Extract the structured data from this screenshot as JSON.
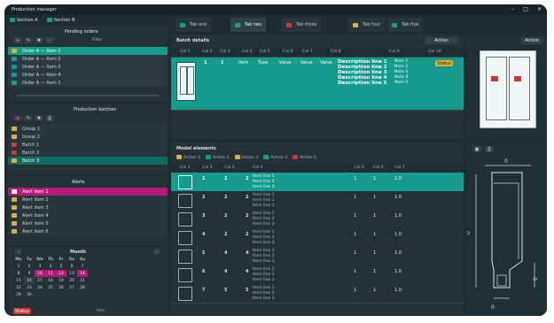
{
  "window": {
    "title": "Production manager"
  },
  "top": {
    "left_header_a": "Section A",
    "left_header_b": "Section B",
    "tabs": [
      {
        "label": "Tab one"
      },
      {
        "label": "Tab two"
      },
      {
        "label": "Tab three"
      },
      {
        "label": "Tab four"
      },
      {
        "label": "Tab five"
      }
    ]
  },
  "left": {
    "pending_title": "Pending orders",
    "pending_filter": "Filter",
    "pending_rows": [
      {
        "text": "Order A — Item 1"
      },
      {
        "text": "Order A — Item 2"
      },
      {
        "text": "Order A — Item 3"
      },
      {
        "text": "Order A — Item 4"
      },
      {
        "text": "Order B — Item 1"
      }
    ],
    "batches_title": "Production batches",
    "batch_rows": [
      {
        "text": "Group 1"
      },
      {
        "text": "Group 2"
      },
      {
        "text": "Batch 1"
      },
      {
        "text": "Batch 2"
      },
      {
        "text": "Batch 3"
      }
    ],
    "alerts_title": "Alerts",
    "alerts_rows": [
      {
        "text": "Alert item 1"
      },
      {
        "text": "Alert item 2"
      },
      {
        "text": "Alert item 3"
      },
      {
        "text": "Alert item 4"
      },
      {
        "text": "Alert item 5"
      },
      {
        "text": "Alert item 6"
      }
    ],
    "calendar": {
      "month": "Month",
      "weekdays": [
        "Mo",
        "Tu",
        "We",
        "Th",
        "Fr",
        "Sa",
        "Su"
      ],
      "days": [
        [
          "1",
          "2",
          "3",
          "4",
          "5",
          "6",
          "7"
        ],
        [
          "8",
          "9",
          "10",
          "11",
          "12",
          "13",
          "14"
        ],
        [
          "15",
          "16",
          "17",
          "18",
          "19",
          "20",
          "21"
        ],
        [
          "22",
          "23",
          "24",
          "25",
          "26",
          "27",
          "28"
        ],
        [
          "29",
          "30",
          "",
          "",
          "",
          "",
          ""
        ],
        [
          "",
          "",
          "",
          "",
          "",
          "",
          ""
        ]
      ],
      "footer_left": "Status",
      "footer_right": "Info"
    }
  },
  "center": {
    "batch_title": "Batch details",
    "cols": [
      "Col 1",
      "Col 2",
      "Col 3",
      "Col 4",
      "Col 5",
      "Col 6",
      "Col 7",
      "Col 8",
      "Col 9",
      "Col 10",
      "Col 11"
    ],
    "row": [
      "1",
      "1",
      "Item",
      "Type",
      "Value",
      "Value",
      "Value",
      "Description line 1\nDescription line 2\nDescription line 3\nDescription line 4\nDescription line 5",
      "Note 1\nNote 2\nNote 3\nNote 4\nNote 5",
      "Status"
    ],
    "details_title": "Model elements",
    "toolbar": [
      "Action 1",
      "Action 2",
      "Action 3",
      "Action 4",
      "Action 5"
    ],
    "details_cols": [
      "Col 1",
      "Col 2",
      "Col 3",
      "Col 4",
      "Col 5",
      "Col 6",
      "Col 7"
    ],
    "details_rows": [
      {
        "a": "1",
        "b": "2",
        "c": "2",
        "desc": "Item line 1\nItem line 2\nItem line 3",
        "q": "1",
        "p": "1",
        "l": "1.0"
      },
      {
        "a": "2",
        "b": "2",
        "c": "2",
        "desc": "Item line 1\nItem line 2\nItem line 3",
        "q": "1",
        "p": "1",
        "l": "1.0"
      },
      {
        "a": "3",
        "b": "2",
        "c": "2",
        "desc": "Item line 1\nItem line 2\nItem line 3",
        "q": "1",
        "p": "1",
        "l": "1.0"
      },
      {
        "a": "4",
        "b": "2",
        "c": "2",
        "desc": "Item line 1\nItem line 2\nItem line 3",
        "q": "1",
        "p": "1",
        "l": "1.0"
      },
      {
        "a": "5",
        "b": "4",
        "c": "4",
        "desc": "Item line 1\nItem line 2\nItem line 3",
        "q": "1",
        "p": "1",
        "l": "1.0"
      },
      {
        "a": "6",
        "b": "4",
        "c": "4",
        "desc": "Item line 1\nItem line 2\nItem line 3",
        "q": "1",
        "p": "1",
        "l": "1.0"
      },
      {
        "a": "7",
        "b": "5",
        "c": "5",
        "desc": "Item line 1\nItem line 2\nItem line 3",
        "q": "1",
        "p": "1",
        "l": "1.0"
      }
    ]
  },
  "right": {
    "header_btn": "Action",
    "diagram": {
      "dim_top": "0",
      "dim_left": "0",
      "dim_right": "0",
      "dim_bottom": "0"
    }
  },
  "colors": {
    "accent": "#159a8c",
    "accent_dark": "#0f6b63",
    "danger": "#c63a3a",
    "magenta": "#b31d7a",
    "warning": "#d8b03a"
  }
}
